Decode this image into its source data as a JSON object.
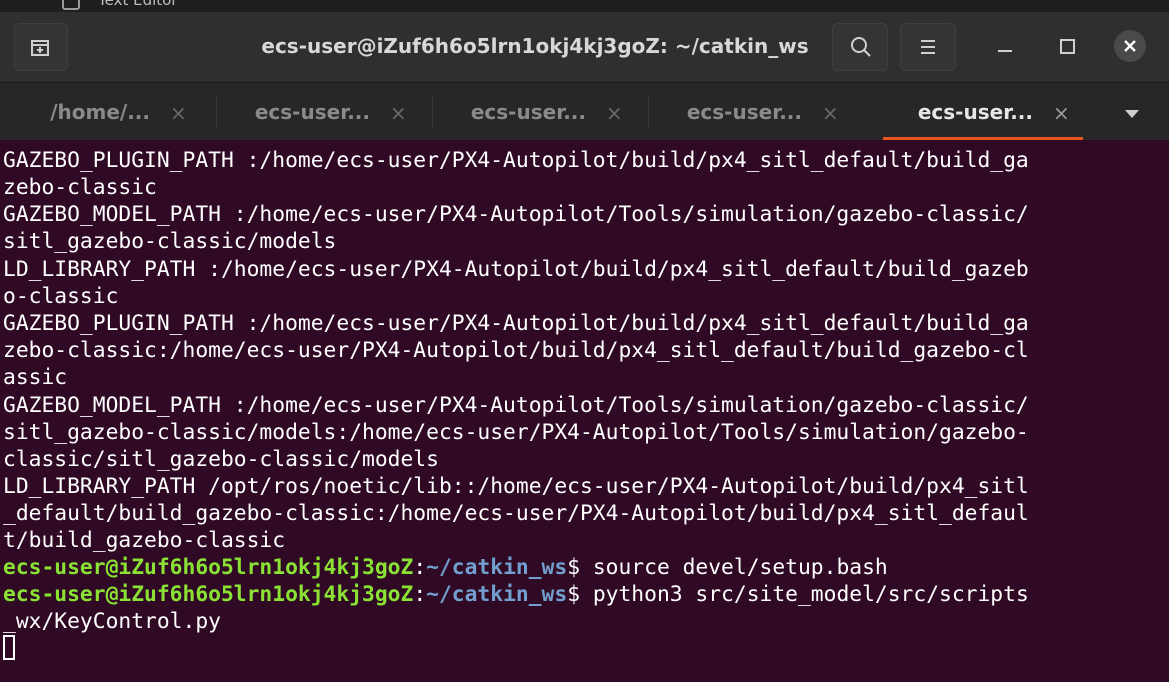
{
  "background_window": {
    "title_fragment": "Text Editor"
  },
  "window": {
    "title": "ecs-user@iZuf6h6o5lrn1okj4kj3goZ: ~/catkin_ws"
  },
  "icons": {
    "new_tab": "new-tab-icon",
    "search": "search-icon",
    "menu": "hamburger-menu-icon",
    "minimize": "minimize-icon",
    "maximize": "maximize-icon",
    "close": "close-icon",
    "tab_close": "tab-close-icon",
    "tabs_dropdown": "chevron-down-icon"
  },
  "colors": {
    "terminal_bg": "#300a24",
    "prompt_user": "#8ae234",
    "prompt_path": "#729fcf",
    "active_tab_accent": "#e95420"
  },
  "tabs": [
    {
      "label": "/home/...",
      "close": "×",
      "active": false
    },
    {
      "label": "ecs-user...",
      "close": "×",
      "active": false
    },
    {
      "label": "ecs-user...",
      "close": "×",
      "active": false
    },
    {
      "label": "ecs-user...",
      "close": "×",
      "active": false
    },
    {
      "label": "ecs-user...",
      "close": "×",
      "active": true
    }
  ],
  "terminal": {
    "lines": [
      "GAZEBO_PLUGIN_PATH :/home/ecs-user/PX4-Autopilot/build/px4_sitl_default/build_ga",
      "zebo-classic",
      "GAZEBO_MODEL_PATH :/home/ecs-user/PX4-Autopilot/Tools/simulation/gazebo-classic/",
      "sitl_gazebo-classic/models",
      "LD_LIBRARY_PATH :/home/ecs-user/PX4-Autopilot/build/px4_sitl_default/build_gazeb",
      "o-classic",
      "GAZEBO_PLUGIN_PATH :/home/ecs-user/PX4-Autopilot/build/px4_sitl_default/build_ga",
      "zebo-classic:/home/ecs-user/PX4-Autopilot/build/px4_sitl_default/build_gazebo-cl",
      "assic",
      "GAZEBO_MODEL_PATH :/home/ecs-user/PX4-Autopilot/Tools/simulation/gazebo-classic/",
      "sitl_gazebo-classic/models:/home/ecs-user/PX4-Autopilot/Tools/simulation/gazebo-",
      "classic/sitl_gazebo-classic/models",
      "LD_LIBRARY_PATH /opt/ros/noetic/lib::/home/ecs-user/PX4-Autopilot/build/px4_sitl",
      "_default/build_gazebo-classic:/home/ecs-user/PX4-Autopilot/build/px4_sitl_defaul",
      "t/build_gazebo-classic"
    ],
    "prompts": [
      {
        "user_host": "ecs-user@iZuf6h6o5lrn1okj4kj3goZ",
        "colon": ":",
        "path": "~/catkin_ws",
        "command": "$ source devel/setup.bash"
      },
      {
        "user_host": "ecs-user@iZuf6h6o5lrn1okj4kj3goZ",
        "colon": ":",
        "path": "~/catkin_ws",
        "command": "$ python3 src/site_model/src/scripts"
      }
    ],
    "wrapped_continuation": "_wx/KeyControl.py"
  }
}
